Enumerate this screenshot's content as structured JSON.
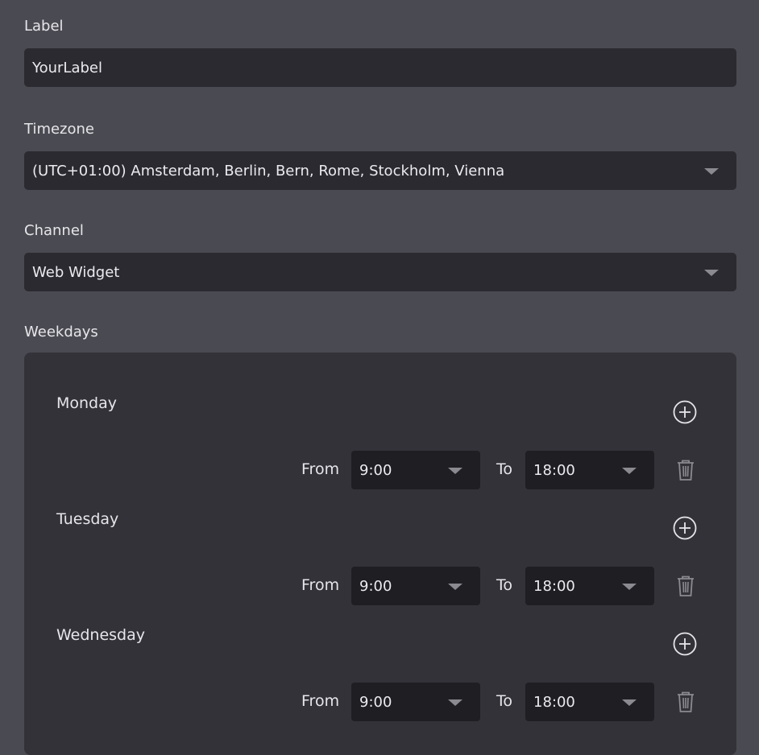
{
  "label_field": {
    "label": "Label",
    "value": "YourLabel"
  },
  "timezone_field": {
    "label": "Timezone",
    "value": "(UTC+01:00) Amsterdam, Berlin, Bern, Rome, Stockholm, Vienna"
  },
  "channel_field": {
    "label": "Channel",
    "value": "Web Widget"
  },
  "weekdays": {
    "label": "Weekdays",
    "days": [
      {
        "name": "Monday",
        "from_label": "From",
        "from": "9:00",
        "to_label": "To",
        "to": "18:00"
      },
      {
        "name": "Tuesday",
        "from_label": "From",
        "from": "9:00",
        "to_label": "To",
        "to": "18:00"
      },
      {
        "name": "Wednesday",
        "from_label": "From",
        "from": "9:00",
        "to_label": "To",
        "to": "18:00"
      }
    ]
  },
  "icons": {
    "add": "plus-circle-icon",
    "delete": "trash-icon",
    "dropdown": "chevron-down-icon"
  },
  "colors": {
    "background": "#4a4a52",
    "input_bg": "#2b2a30",
    "panel_bg": "#333238",
    "time_select_bg": "#1f1e23",
    "text": "#e8e8ec",
    "icon": "#8a8a90"
  }
}
